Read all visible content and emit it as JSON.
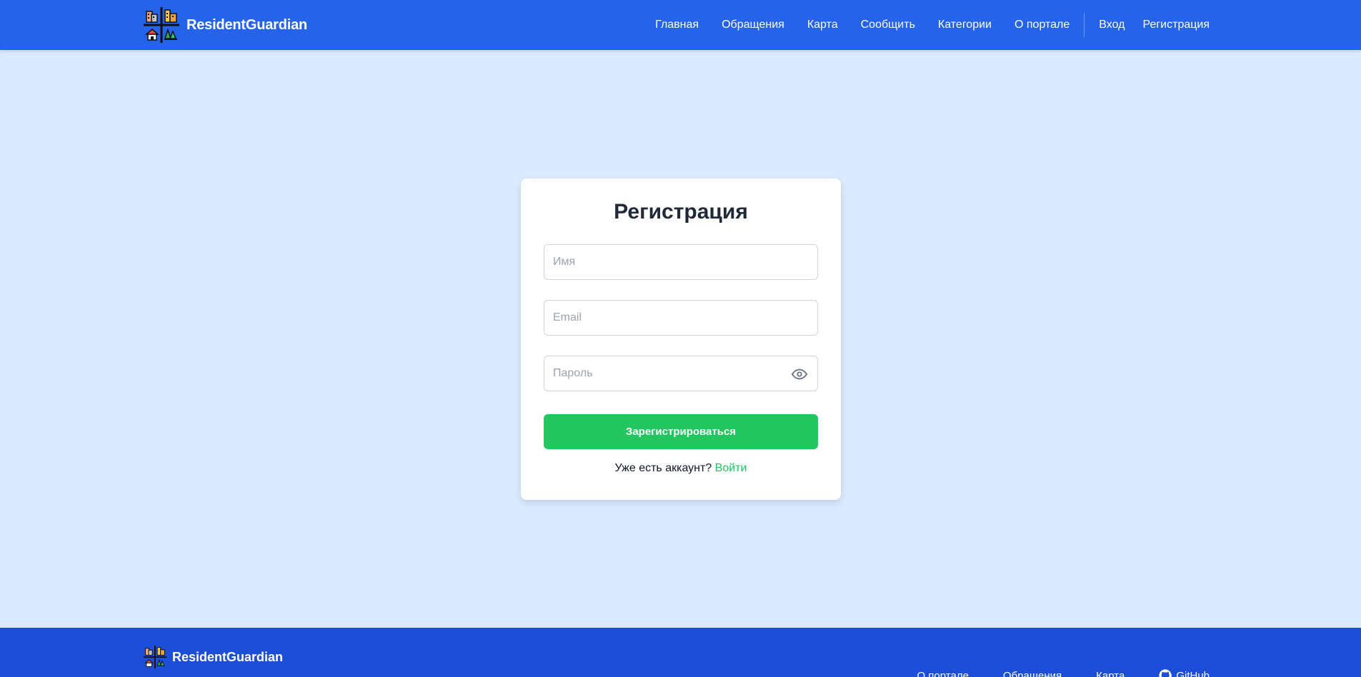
{
  "header": {
    "brand": "ResidentGuardian",
    "nav": [
      "Главная",
      "Обращения",
      "Карта",
      "Сообщить",
      "Категории",
      "О портале"
    ],
    "login": "Вход",
    "register": "Регистрация"
  },
  "form": {
    "title": "Регистрация",
    "name_placeholder": "Имя",
    "email_placeholder": "Email",
    "password_placeholder": "Пароль",
    "submit_label": "Зарегистрироваться",
    "have_account": "Уже есть аккаунт?",
    "login_link": "Войти"
  },
  "footer": {
    "brand": "ResidentGuardian",
    "links": [
      "О портале",
      "Обращения",
      "Карта"
    ],
    "github": "GitHub"
  },
  "colors": {
    "header": "#2563eb",
    "page_bg": "#dbeafe",
    "footer": "#1d4ed8",
    "accent_green": "#22c55e"
  }
}
